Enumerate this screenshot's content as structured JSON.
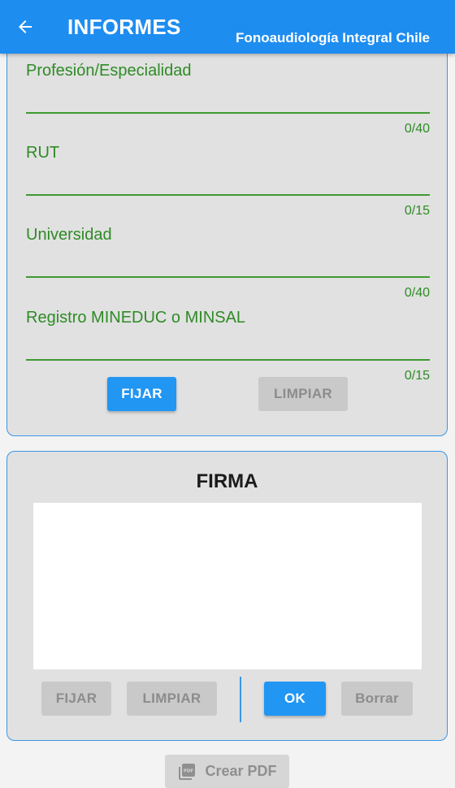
{
  "appbar": {
    "title": "INFORMES",
    "subtitle": "Fonoaudiología Integral Chile",
    "back_icon": "arrow-left-icon",
    "color": "#1e8df0"
  },
  "form": {
    "fields": [
      {
        "label": "Profesión/Especialidad",
        "counter": "0/40"
      },
      {
        "label": "RUT",
        "counter": "0/15"
      },
      {
        "label": "Universidad",
        "counter": "0/40"
      },
      {
        "label": "Registro MINEDUC o MINSAL",
        "counter": "0/15"
      }
    ],
    "fix_label": "FIJAR",
    "clear_label": "LIMPIAR",
    "accent_color": "#2e8b25"
  },
  "signature": {
    "title": "FIRMA",
    "fix_label": "FIJAR",
    "clear_label": "LIMPIAR",
    "ok_label": "OK",
    "erase_label": "Borrar"
  },
  "footer": {
    "pdf_label": "Crear PDF",
    "pdf_icon": "pdf-file-icon"
  }
}
